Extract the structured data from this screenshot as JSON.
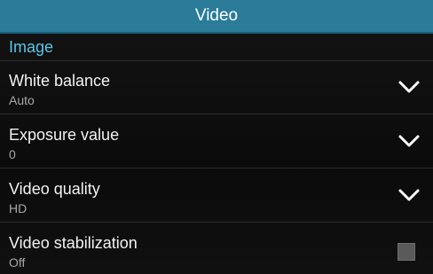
{
  "header": {
    "title": "Video"
  },
  "section": {
    "label": "Image"
  },
  "settings": [
    {
      "label": "White balance",
      "value": "Auto",
      "control": "dropdown",
      "icon": "chevron-down-icon"
    },
    {
      "label": "Exposure value",
      "value": "0",
      "control": "dropdown",
      "icon": "chevron-down-icon"
    },
    {
      "label": "Video quality",
      "value": "HD",
      "control": "dropdown",
      "icon": "chevron-down-icon"
    },
    {
      "label": "Video stabilization",
      "value": "Off",
      "control": "checkbox",
      "checked": false
    }
  ],
  "colors": {
    "header_bg": "#2a7c99",
    "section_text": "#5fc3e6",
    "background": "#0d0d0d"
  }
}
